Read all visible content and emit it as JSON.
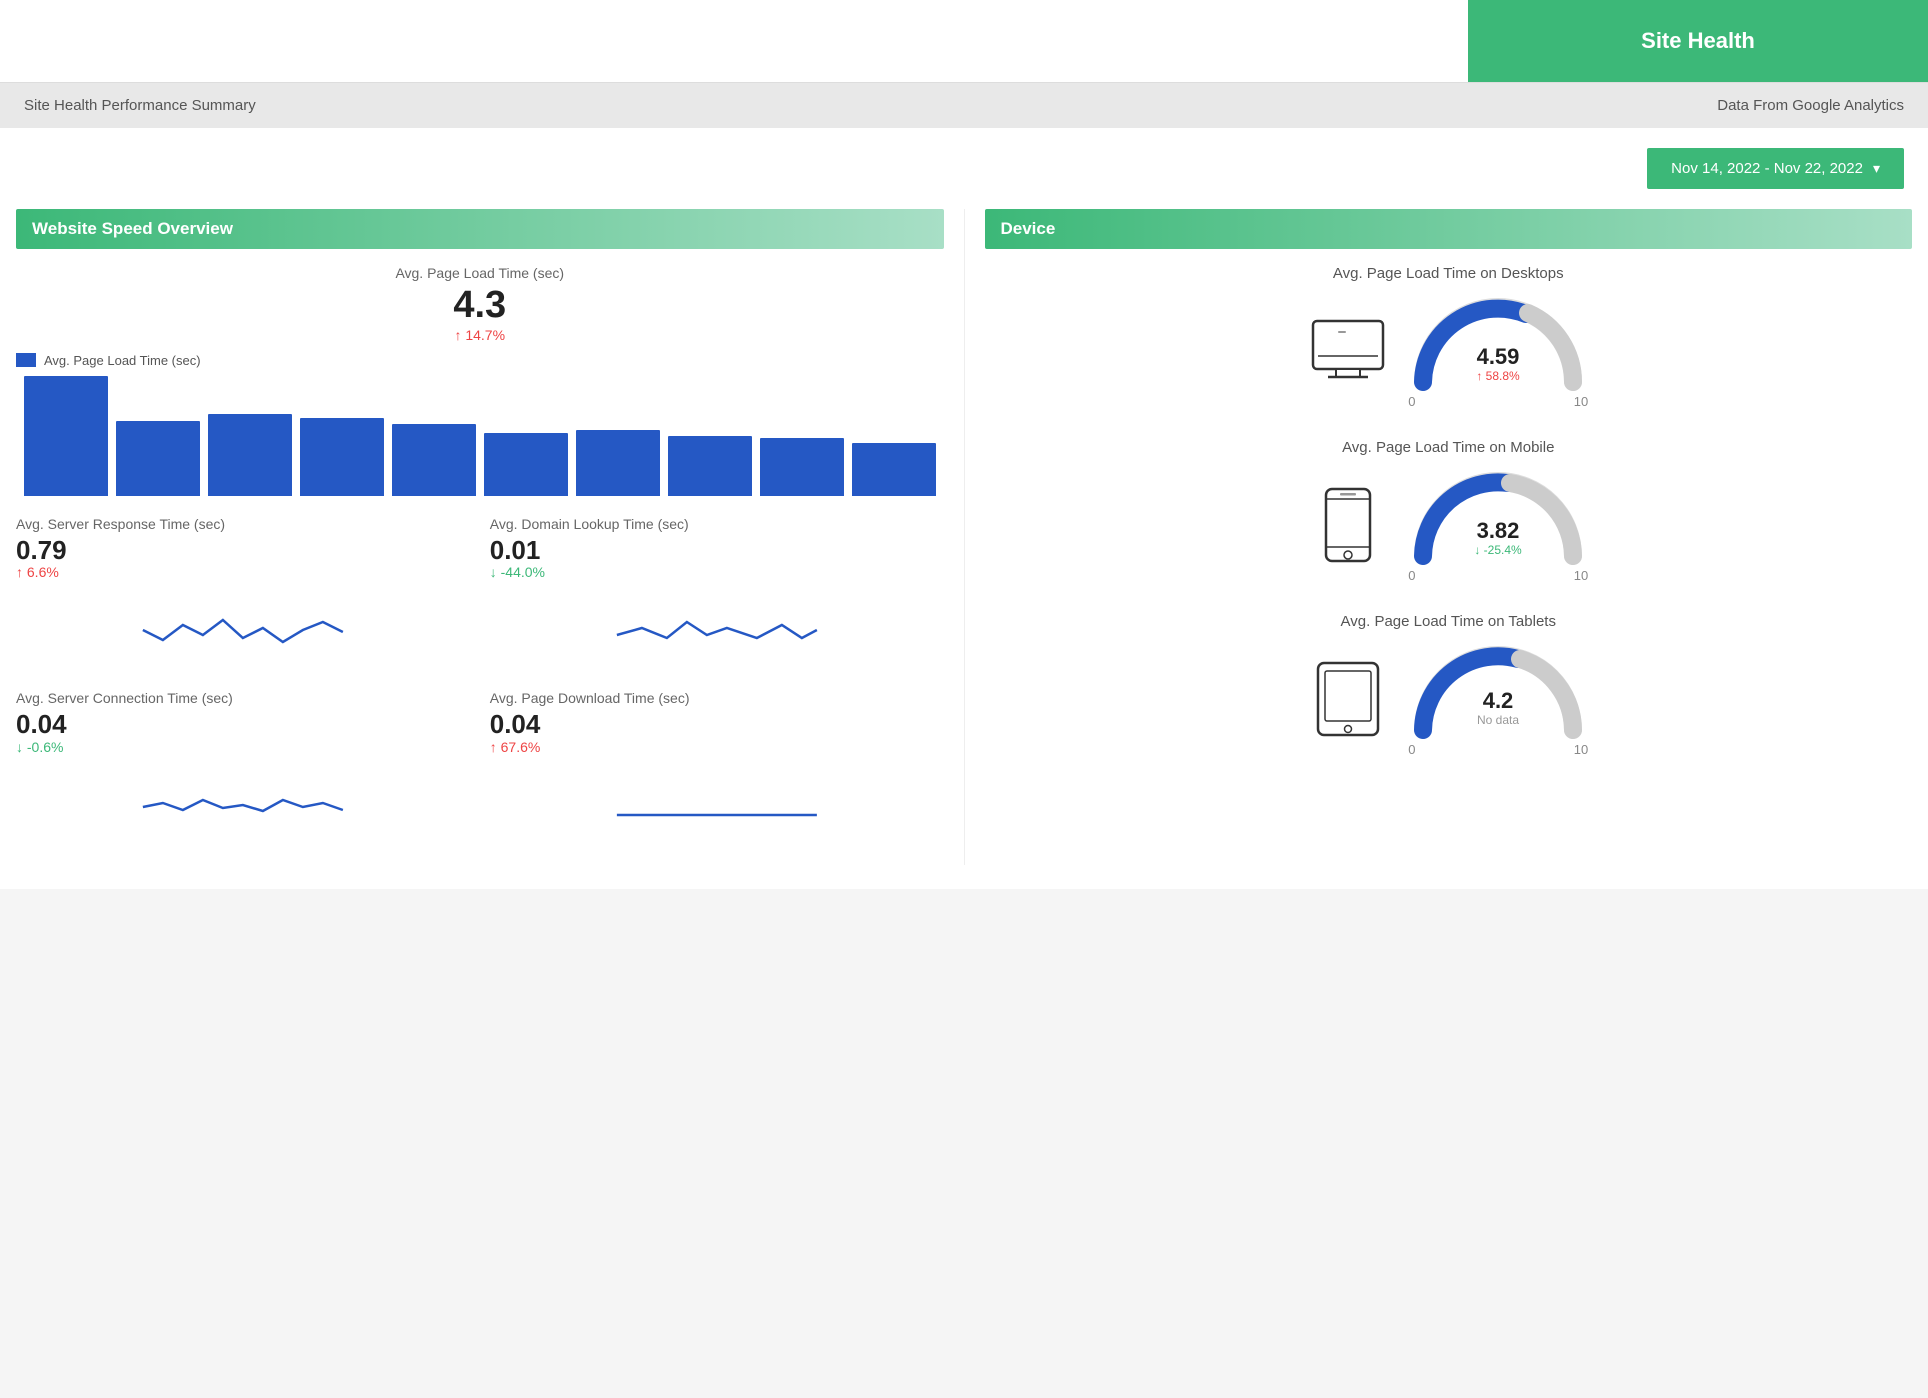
{
  "header": {
    "title": "Site Health",
    "subtitle": "Site Health Performance Summary",
    "data_source": "Data From Google Analytics"
  },
  "date_range": {
    "label": "Nov 14, 2022 - Nov 22, 2022",
    "chevron": "▾"
  },
  "left_section": {
    "header": "Website Speed Overview",
    "avg_page_load": {
      "title": "Avg. Page Load Time (sec)",
      "value": "4.3",
      "change": "↑ 14.7%",
      "change_type": "up"
    },
    "legend_label": "Avg. Page Load Time (sec)",
    "bars": [
      100,
      62,
      68,
      65,
      60,
      52,
      55,
      50,
      48,
      44
    ],
    "server_response": {
      "title": "Avg. Server Response Time (sec)",
      "value": "0.79",
      "change": "↑ 6.6%",
      "change_type": "up"
    },
    "domain_lookup": {
      "title": "Avg. Domain Lookup Time (sec)",
      "value": "0.01",
      "change": "↓ -44.0%",
      "change_type": "down"
    },
    "server_connection": {
      "title": "Avg. Server Connection Time (sec)",
      "value": "0.04",
      "change": "↓ -0.6%",
      "change_type": "down"
    },
    "page_download": {
      "title": "Avg. Page Download Time (sec)",
      "value": "0.04",
      "change": "↑ 67.6%",
      "change_type": "up"
    }
  },
  "right_section": {
    "header": "Device",
    "desktop": {
      "title": "Avg. Page Load Time on Desktops",
      "value": "4.59",
      "change": "↑ 58.8%",
      "change_type": "up",
      "fill_pct": 0.459,
      "min": "0",
      "max": "10"
    },
    "mobile": {
      "title": "Avg. Page Load Time on Mobile",
      "value": "3.82",
      "change": "↓ -25.4%",
      "change_type": "down",
      "fill_pct": 0.382,
      "min": "0",
      "max": "10"
    },
    "tablet": {
      "title": "Avg. Page Load Time on Tablets",
      "value": "4.2",
      "change": "No data",
      "change_type": "neutral",
      "fill_pct": 0.42,
      "min": "0",
      "max": "10"
    }
  }
}
